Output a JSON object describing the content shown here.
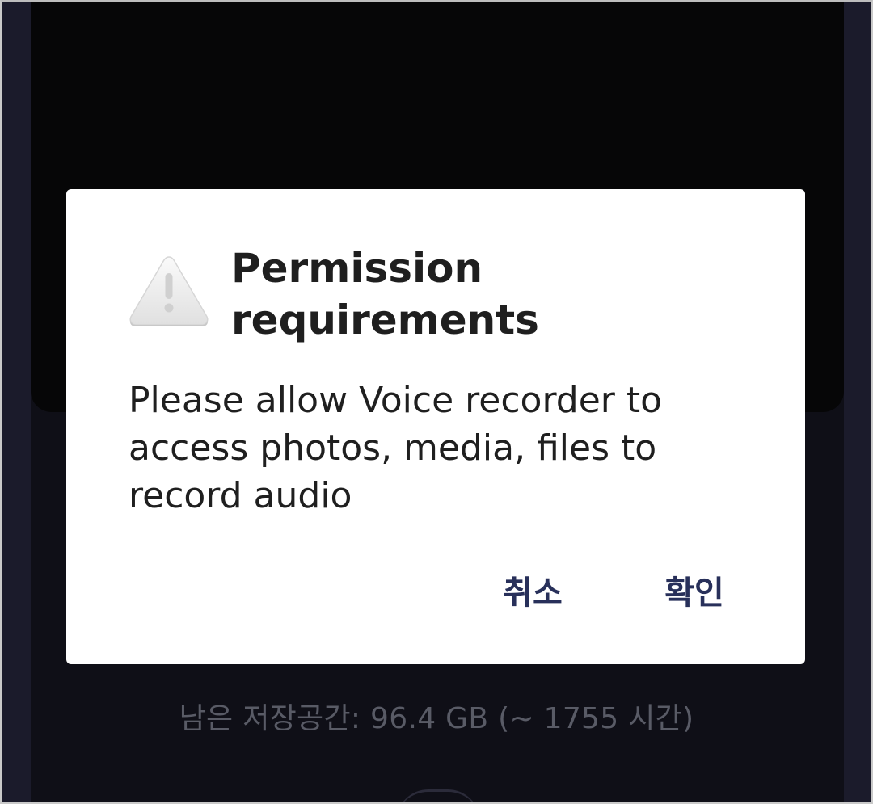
{
  "dialog": {
    "title": "Permission requirements",
    "message": "Please allow Voice recorder to access photos, media, files to record audio",
    "icon": "warning-icon",
    "cancel_label": "취소",
    "ok_label": "확인"
  },
  "background": {
    "storage_info": "남은 저장공간: 96.4 GB (~ 1755 시간)"
  },
  "colors": {
    "dialog_bg": "#ffffff",
    "button_text": "#28305a",
    "screen_bg": "#0f0f17",
    "storage_text": "#595b66"
  }
}
